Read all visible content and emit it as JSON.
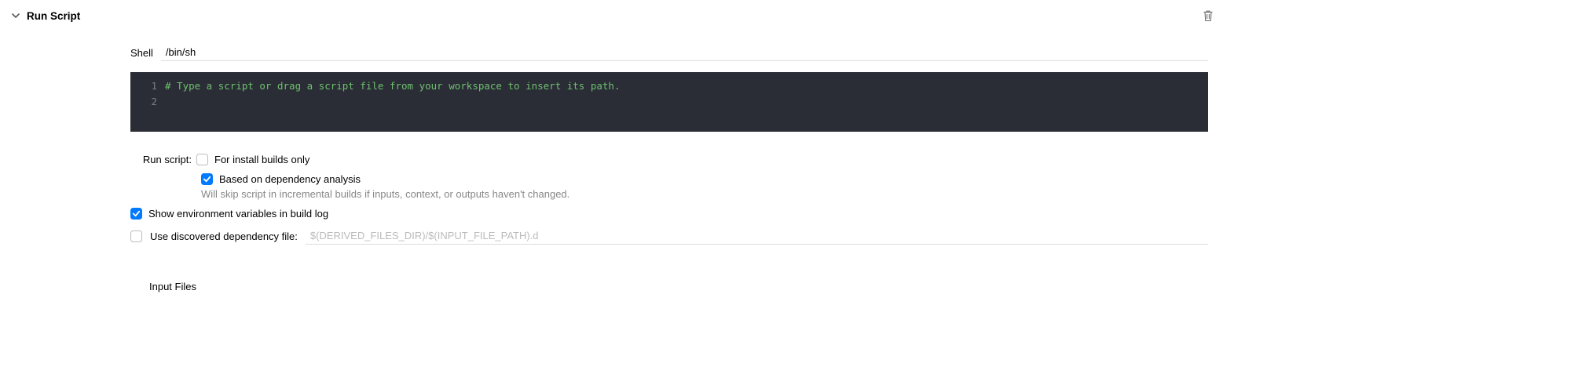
{
  "header": {
    "title": "Run Script"
  },
  "shell": {
    "label": "Shell",
    "value": "/bin/sh"
  },
  "editor": {
    "lines": [
      "1",
      "2"
    ],
    "comment": "# Type a script or drag a script file from your workspace to insert its path."
  },
  "options": {
    "run_script_label": "Run script:",
    "install_only": {
      "checked": false,
      "label": "For install builds only"
    },
    "dependency_analysis": {
      "checked": true,
      "label": "Based on dependency analysis",
      "hint": "Will skip script in incremental builds if inputs, context, or outputs haven't changed."
    },
    "show_env": {
      "checked": true,
      "label": "Show environment variables in build log"
    },
    "discovered_dep": {
      "checked": false,
      "label": "Use discovered dependency file:",
      "placeholder": "$(DERIVED_FILES_DIR)/$(INPUT_FILE_PATH).d"
    }
  },
  "sections": {
    "input_files": "Input Files"
  }
}
